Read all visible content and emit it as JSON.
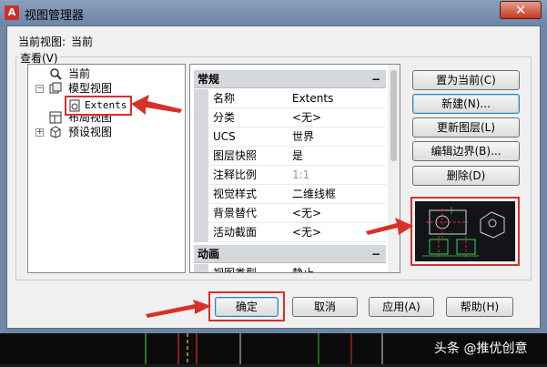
{
  "window": {
    "title": "视图管理器",
    "app_icon_glyph": "A",
    "close_glyph": "✕"
  },
  "current_view": {
    "label": "当前视图:",
    "value": "当前"
  },
  "views_group": {
    "label": "查看(V)"
  },
  "tree": {
    "items": [
      {
        "label": "当前",
        "icon": "magnifier-icon"
      },
      {
        "label": "模型视图",
        "icon": "model-view-icon",
        "expander": "−"
      },
      {
        "label": "Extents",
        "icon": "view-document-icon"
      },
      {
        "label": "布局视图",
        "icon": "layout-view-icon"
      },
      {
        "label": "预设视图",
        "icon": "preset-view-icon",
        "expander": "+"
      }
    ]
  },
  "properties": {
    "sections": [
      {
        "title": "常规",
        "collapse": "−",
        "rows": [
          {
            "name": "名称",
            "value": "Extents"
          },
          {
            "name": "分类",
            "value": "<无>"
          },
          {
            "name": "UCS",
            "value": "世界"
          },
          {
            "name": "图层快照",
            "value": "是"
          },
          {
            "name": "注释比例",
            "value": "1:1",
            "disabled": true
          },
          {
            "name": "视觉样式",
            "value": "二维线框"
          },
          {
            "name": "背景替代",
            "value": "<无>"
          },
          {
            "name": "活动截面",
            "value": "<无>"
          }
        ]
      },
      {
        "title": "动画",
        "collapse": "−",
        "rows": [
          {
            "name": "视图类型",
            "value": "静止"
          }
        ]
      }
    ]
  },
  "buttons": {
    "set_current": "置为当前(C)",
    "new": "新建(N)...",
    "update_layers": "更新图层(L)",
    "edit_boundaries": "编辑边界(B)...",
    "delete": "删除(D)",
    "ok": "确定",
    "cancel": "取消",
    "apply": "应用(A)",
    "help": "帮助(H)"
  },
  "colors": {
    "annotation": "#d8302a",
    "title_bar": "#6f86a6",
    "preview_bg": "#121418"
  },
  "watermark": "头条 @推优创意"
}
